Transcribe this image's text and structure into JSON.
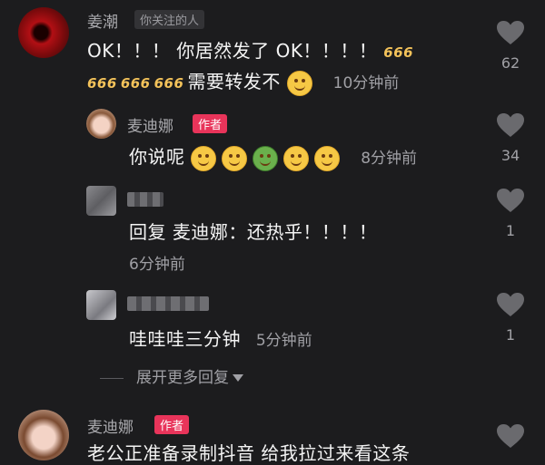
{
  "comments": [
    {
      "username": "姜潮",
      "tag": "你关注的人",
      "text_main": "OK！！！ 你居然发了 OK！！！！",
      "text_line2": "需要转发不",
      "sixes_icon": "666-emoji",
      "time": "10分钟前",
      "likes": "62"
    },
    {
      "username": "麦迪娜",
      "tag": "作者",
      "text": "你说呢",
      "time": "8分钟前",
      "likes": "34"
    },
    {
      "username": "",
      "text": "回复 麦迪娜：还热乎！！！！",
      "time": "6分钟前",
      "likes": "1"
    },
    {
      "username": "",
      "text": "哇哇哇三分钟",
      "time": "5分钟前",
      "likes": "1"
    },
    {
      "username": "麦迪娜",
      "tag": "作者",
      "text": "老公正准备录制抖音 给我拉过来看这条"
    }
  ],
  "expand_label": "展开更多回复",
  "colors": {
    "author_tag": "#e8345a",
    "background": "#1c1c1e"
  }
}
